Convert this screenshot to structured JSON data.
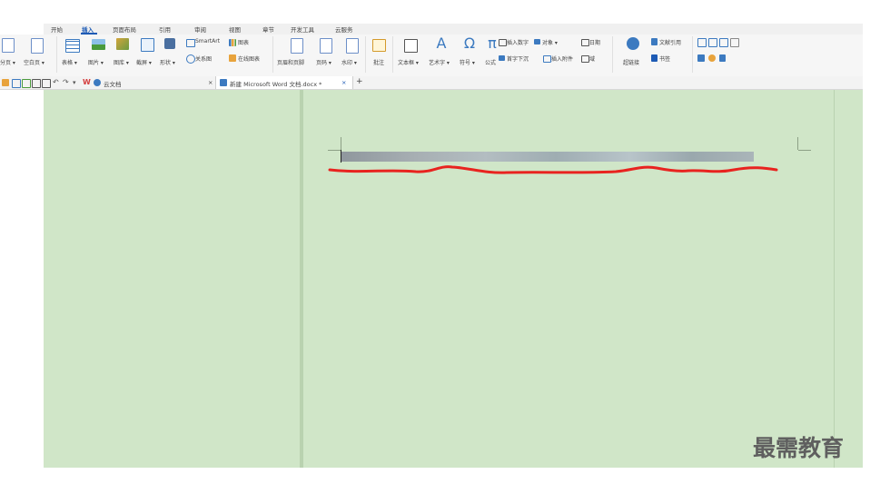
{
  "menu": {
    "tabs": [
      "开始",
      "插入",
      "页面布局",
      "引用",
      "审阅",
      "视图",
      "章节",
      "开发工具",
      "云服务"
    ],
    "active": "插入"
  },
  "ribbon": {
    "labels": {
      "fenye": "分页 ▾",
      "kongbaiye": "空白页 ▾",
      "biaoge": "表格 ▾",
      "tupian": "图片 ▾",
      "tuku": "图库 ▾",
      "jieping": "截屏 ▾",
      "xingzhuang": "形状 ▾",
      "smartart": "SmartArt",
      "tubiao": "图表",
      "guanxitu": "关系图",
      "zaixiantubiao": "在线图表",
      "yemeiyejiao": "页眉和页脚",
      "yema": "页码 ▾",
      "shuiyin": "水印 ▾",
      "pizhu": "批注",
      "wenbenkuang": "文本框 ▾",
      "yishuzi": "艺术字 ▾",
      "fuhao": "符号 ▾",
      "gongshi": "公式",
      "charushuzi": "插入数字",
      "duixiang": "对象 ▾",
      "riqi": "日期",
      "shouzixiachen": "首字下沉",
      "charufujian": "插入附件",
      "yu": "域",
      "chaolianjie": "超链接",
      "shuqian": "书签",
      "wenxianyinyong": "文献引用"
    }
  },
  "tabrow": {
    "cloud_label": "云文档",
    "doc_title": "新建 Microsoft Word 文档.docx *",
    "close_symbol": "×",
    "new_tab_symbol": "+"
  },
  "watermark": "最需教育",
  "colors": {
    "workspace": "#d0e6c8",
    "accent": "#1e5bb5",
    "red_annotation": "#e8231f"
  }
}
